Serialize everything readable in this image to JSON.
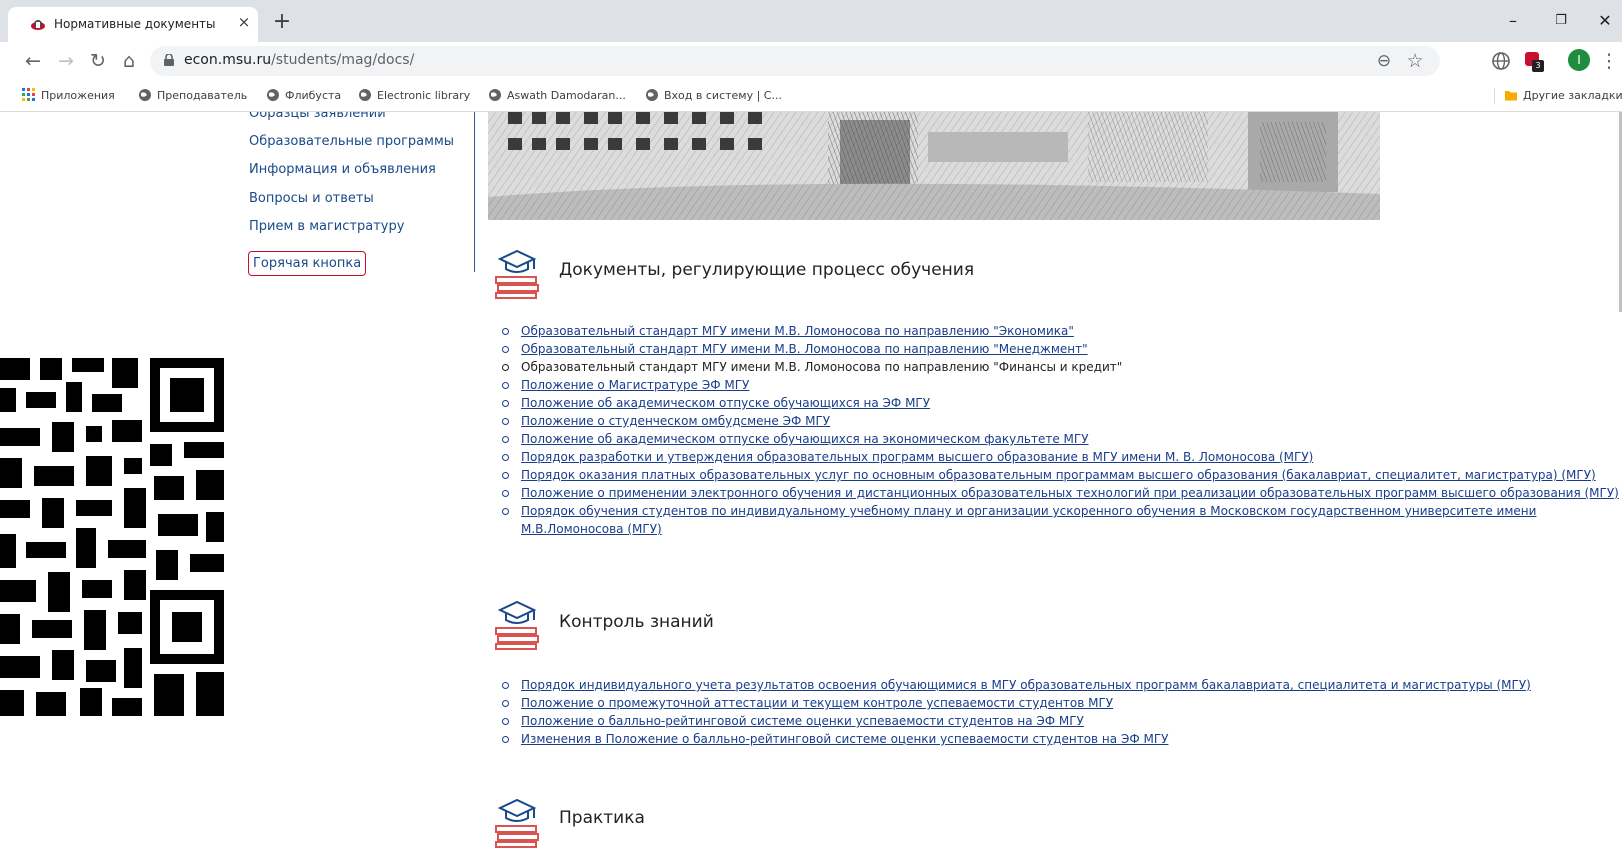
{
  "browser": {
    "tab_title": "Нормативные документы",
    "tab_close": "×",
    "new_tab": "+",
    "url_host": "econ.msu.ru",
    "url_path": "/students/mag/docs/",
    "window": {
      "minimize": "–",
      "restore": "❐",
      "close": "✕"
    },
    "nav": {
      "back": "←",
      "forward": "→",
      "reload": "↻",
      "home": "⌂"
    },
    "omnibox_icons": {
      "zoom": "⊖",
      "star": "☆"
    },
    "profile_initial": "I",
    "extension_badge": "3",
    "menu": "⋮"
  },
  "bookmarks": {
    "apps": "Приложения",
    "items": [
      "Преподаватель",
      "Флибуста",
      "Electronic library",
      "Aswath Damodaran...",
      "Вход в систему | С..."
    ],
    "other": "Другие закладки"
  },
  "sidebar": {
    "links": [
      "Образцы заявлений",
      "Образовательные программы",
      "Информация и объявления",
      "Вопросы и ответы",
      "Прием в магистратуру"
    ],
    "hot_button": "Горячая кнопка"
  },
  "sections": [
    {
      "title": "Документы, регулирующие процесс обучения",
      "docs": [
        {
          "text": "Образовательный стандарт МГУ имени М.В. Ломоносова по направлению \"Экономика\"",
          "link": true
        },
        {
          "text": "Образовательный стандарт МГУ имени М.В. Ломоносова по направлению \"Менеджмент\"",
          "link": true
        },
        {
          "text": "Образовательный стандарт МГУ имени М.В. Ломоносова по направлению \"Финансы и кредит\"",
          "link": false
        },
        {
          "text": "Положение о Магистратуре ЭФ МГУ",
          "link": true
        },
        {
          "text": "Положение об академическом отпуске обучающихся на ЭФ МГУ",
          "link": true
        },
        {
          "text": "Положение о студенческом омбудсмене ЭФ МГУ",
          "link": true
        },
        {
          "text": "Положение об академическом отпуске обучающихся на экономическом факультете МГУ",
          "link": true
        },
        {
          "text": "Порядок разработки и утверждения образовательных программ высшего образование в МГУ имени М. В. Ломоносова (МГУ)",
          "link": true
        },
        {
          "text": "Порядок оказания платных образовательных услуг по основным образовательным программам высшего образования (бакалавриат, специалитет, магистратура) (МГУ)",
          "link": true
        },
        {
          "text": "Положение о применении электронного обучения и дистанционных образовательных технологий при реализации образовательных программ высшего образования (МГУ)",
          "link": true
        },
        {
          "text": "Порядок обучения студентов по индивидуальному учебному плану и организации ускоренного обучения в Московском государственном университете имени М.В.Ломоносова (МГУ)",
          "link": true
        }
      ]
    },
    {
      "title": "Контроль знаний",
      "docs": [
        {
          "text": "Порядок индивидуального учета результатов освоения обучающимися в МГУ образовательных программ бакалавриата, специалитета и магистратуры (МГУ)",
          "link": true
        },
        {
          "text": "Положение о промежуточной аттестации и текущем контроле успеваемости студентов МГУ",
          "link": true
        },
        {
          "text": "Положение о балльно-рейтинговой системе оценки успеваемости студентов на ЭФ МГУ",
          "link": true
        },
        {
          "text": "Изменения в Положение о балльно-рейтинговой системе оценки успеваемости студентов на ЭФ МГУ",
          "link": true
        }
      ]
    },
    {
      "title": "Практика",
      "docs": []
    }
  ],
  "colors": {
    "link": "#1a3e8c",
    "hot_border": "#c8102e",
    "icon_red": "#d9534f",
    "icon_blue": "#1a4a8a"
  },
  "icons": {
    "section_icon": "graduation-cap-books-icon",
    "lock": "lock-icon",
    "globe": "globe-icon"
  }
}
